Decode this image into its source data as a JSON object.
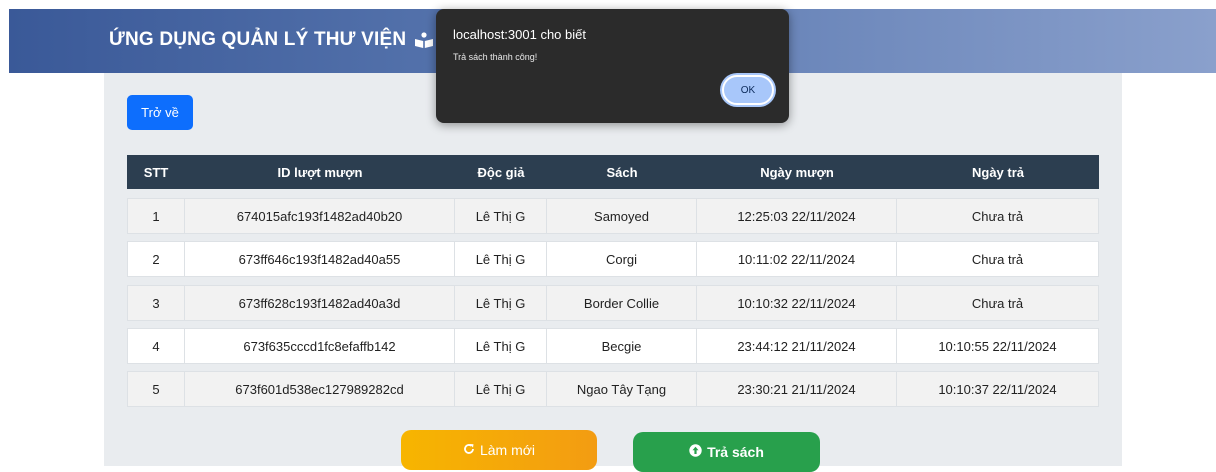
{
  "header": {
    "title": "ỨNG DỤNG QUẢN LÝ THƯ VIỆN",
    "icon": "book-reader-icon"
  },
  "back_button": {
    "label": "Trở về"
  },
  "table": {
    "headers": [
      "STT",
      "ID lượt mượn",
      "Độc giả",
      "Sách",
      "Ngày mượn",
      "Ngày trả"
    ],
    "rows": [
      [
        "1",
        "674015afc193f1482ad40b20",
        "Lê Thị G",
        "Samoyed",
        "12:25:03 22/11/2024",
        "Chưa trả"
      ],
      [
        "2",
        "673ff646c193f1482ad40a55",
        "Lê Thị G",
        "Corgi",
        "10:11:02 22/11/2024",
        "Chưa trả"
      ],
      [
        "3",
        "673ff628c193f1482ad40a3d",
        "Lê Thị G",
        "Border Collie",
        "10:10:32 22/11/2024",
        "Chưa trả"
      ],
      [
        "4",
        "673f635cccd1fc8efaffb142",
        "Lê Thị G",
        "Becgie",
        "23:44:12 21/11/2024",
        "10:10:55 22/11/2024"
      ],
      [
        "5",
        "673f601d538ec127989282cd",
        "Lê Thị G",
        "Ngao Tây Tạng",
        "23:30:21 21/11/2024",
        "10:10:37 22/11/2024"
      ]
    ]
  },
  "actions": {
    "refresh_label": "Làm mới",
    "refresh_icon": "refresh-icon",
    "return_label": "Trả sách",
    "return_icon": "arrow-circle-up-icon"
  },
  "dialog": {
    "title": "localhost:3001 cho biết",
    "message": "Trả sách thành công!",
    "ok_label": "OK"
  },
  "colors": {
    "header_start": "#3a5998",
    "header_end": "#8aa0cc",
    "table_header": "#2c3e50",
    "primary": "#0d6efd",
    "warning": "#f7b500",
    "success": "#28a04c",
    "dialog_bg": "#2b2b2b",
    "dialog_button": "#a8c7fa"
  }
}
